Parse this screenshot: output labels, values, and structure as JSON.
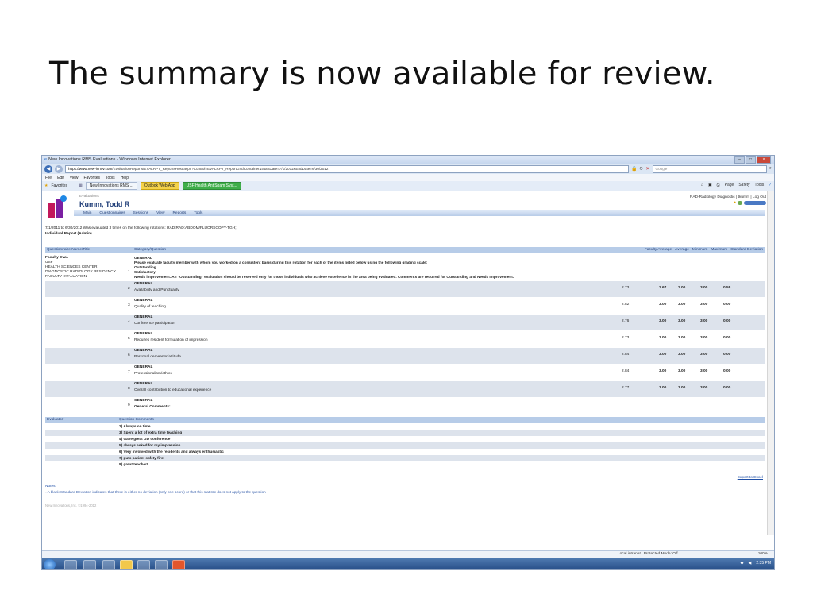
{
  "slide": {
    "title": "The summary is now available for review."
  },
  "browser": {
    "window_title": "New Innovations RMS Evaluations - Windows Internet Explorer",
    "address_host": "https://www.new-innov.com",
    "address_path": "/EvaluationReports/EVALRPT_ReportsHost.aspx?Control=EVALRPT_ReportGridContainer&StartDate=7/1/2011&EndDate=6/30/2012",
    "search_placeholder": "Google",
    "menu": [
      "File",
      "Edit",
      "View",
      "Favorites",
      "Tools",
      "Help"
    ],
    "favorites_label": "Favorites",
    "tabs": [
      "New Innovations RMS ...",
      "Outlook Web App",
      "USF Health AntiSpam Syst..."
    ],
    "toolbar_items": [
      "Page",
      "Safety",
      "Tools"
    ]
  },
  "app": {
    "section": "Evaluations",
    "user_name": "Kumm, Todd R",
    "top_right": "RAD-Radiology Diagnostic | tkumm | Log Out",
    "nav": [
      "Main",
      "Questionnaires",
      "Sessions",
      "View",
      "Reports",
      "Tools"
    ],
    "line1": "7/1/2011 to 6/30/2012 Was evaluated 3 times on the following rotations: RAD:RAD:ABDOM/FLUORSCOPY-TGH;",
    "line2": "Individual Report (Admin)"
  },
  "table": {
    "headers": {
      "name": "Questionnaire Name/Title",
      "category": "Category/Question",
      "faculty_average": "Faculty Average",
      "average": "Average",
      "minimum": "Minimum",
      "maximum": "Maximum",
      "std_dev": "Standard Deviation"
    },
    "questionnaire_lines": [
      "Faculty Eval.",
      "USF",
      "HEALTH SCIENCES CENTER",
      "DIAGNOSTIC RADIOLOGY RESIDENCY",
      "FACULTY EVALUATION"
    ],
    "intro": {
      "num": "1",
      "category": "GENERAL",
      "lines": [
        "Please evaluate faculty member with whom you worked on a consistent basis during this rotation for each of the items listed below using the following grading scale:",
        "Outstanding",
        "Satisfactory",
        "Needs improvement. An \"Outstanding\" evaluation should be reserved only for those individuals who achieve excellence in the area being evaluated. Comments are required for Outstanding and Needs Improvement."
      ]
    },
    "rows": [
      {
        "num": "2",
        "category": "GENERAL",
        "question": "Availability and Punctuality",
        "faculty_average": "2.73",
        "average": "2.67",
        "minimum": "2.00",
        "maximum": "3.00",
        "std_dev": "0.58"
      },
      {
        "num": "3",
        "category": "GENERAL",
        "question": "Quality of teaching",
        "faculty_average": "2.82",
        "average": "3.00",
        "minimum": "3.00",
        "maximum": "3.00",
        "std_dev": "0.00"
      },
      {
        "num": "4",
        "category": "GENERAL",
        "question": "Conference participation",
        "faculty_average": "2.76",
        "average": "3.00",
        "minimum": "3.00",
        "maximum": "3.00",
        "std_dev": "0.00"
      },
      {
        "num": "5",
        "category": "GENERAL",
        "question": "Requires resident formulation of impression",
        "faculty_average": "2.73",
        "average": "3.00",
        "minimum": "3.00",
        "maximum": "3.00",
        "std_dev": "0.00"
      },
      {
        "num": "6",
        "category": "GENERAL",
        "question": "Personal demeanor/attitude",
        "faculty_average": "2.84",
        "average": "3.00",
        "minimum": "3.00",
        "maximum": "3.00",
        "std_dev": "0.00"
      },
      {
        "num": "7",
        "category": "GENERAL",
        "question": "Professionalism/ethics",
        "faculty_average": "2.84",
        "average": "3.00",
        "minimum": "3.00",
        "maximum": "3.00",
        "std_dev": "0.00"
      },
      {
        "num": "8",
        "category": "GENERAL",
        "question": "Overall contribution to educational experience",
        "faculty_average": "2.77",
        "average": "3.00",
        "minimum": "3.00",
        "maximum": "3.00",
        "std_dev": "0.00"
      },
      {
        "num": "9",
        "category": "GENERAL",
        "question": "General Comments:",
        "faculty_average": "",
        "average": "",
        "minimum": "",
        "maximum": "",
        "std_dev": ""
      }
    ]
  },
  "comments": {
    "header_evaluator": "Evaluator",
    "header_comments": "Question Comments",
    "items": [
      "2) Always on time",
      "3) Spent a lot of extra time teaching",
      "4) Gave great GU conference",
      "5) always asked for my impression",
      "6) Very involved with the residents and always enthusiastic",
      "7) puts patient safety first",
      "8) great teacher!"
    ]
  },
  "footer": {
    "export": "Export to Excel",
    "notes_label": "Notes:",
    "note1": "A blank Standard Deviation indicates that there is either no deviation (only one score) or that this statistic does not apply to the question",
    "copyright": "New Innovations, Inc. ©1994-2012"
  },
  "status": {
    "zone": "Local intranet | Protected Mode: Off",
    "zoom": "100%",
    "time": "2:35 PM"
  }
}
